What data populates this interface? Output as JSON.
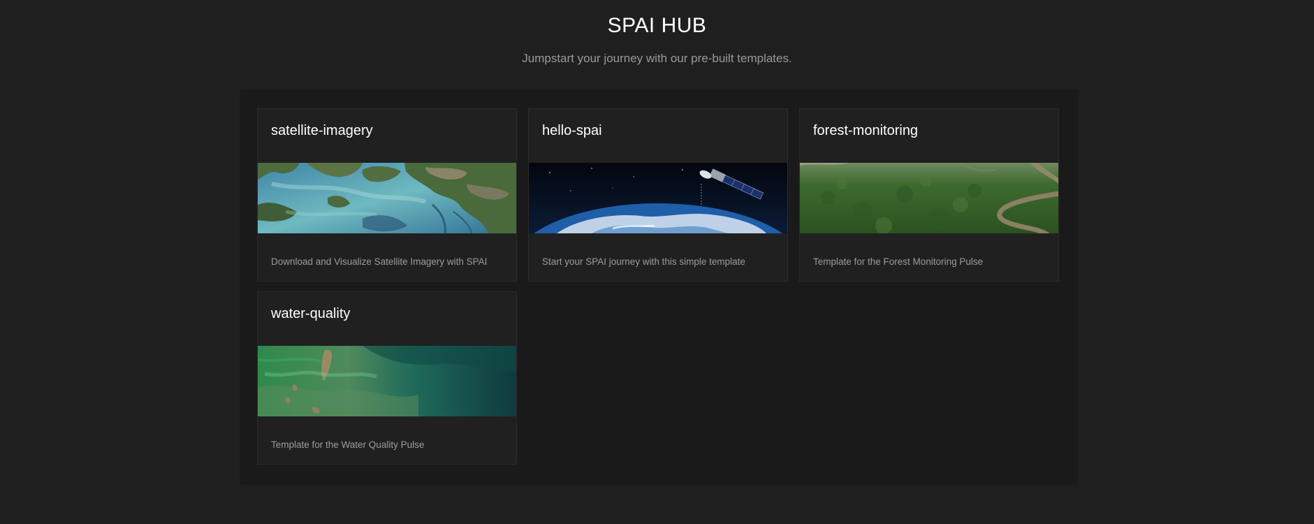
{
  "header": {
    "title": "SPAI HUB",
    "subtitle": "Jumpstart your journey with our pre-built templates."
  },
  "templates": [
    {
      "title": "satellite-imagery",
      "description": "Download and Visualize Satellite Imagery with SPAI",
      "image": "satellite-coastline-image"
    },
    {
      "title": "hello-spai",
      "description": "Start your SPAI journey with this simple template",
      "image": "earth-and-satellite-image"
    },
    {
      "title": "forest-monitoring",
      "description": "Template for the Forest Monitoring Pulse",
      "image": "forest-river-aerial-image"
    },
    {
      "title": "water-quality",
      "description": "Template for the Water Quality Pulse",
      "image": "algae-water-satellite-image"
    }
  ],
  "colors": {
    "background": "#1f1f1f",
    "panel": "#1a1a1b",
    "card": "#202020",
    "title": "#ffffff",
    "muted_text": "#9a9a9a"
  }
}
